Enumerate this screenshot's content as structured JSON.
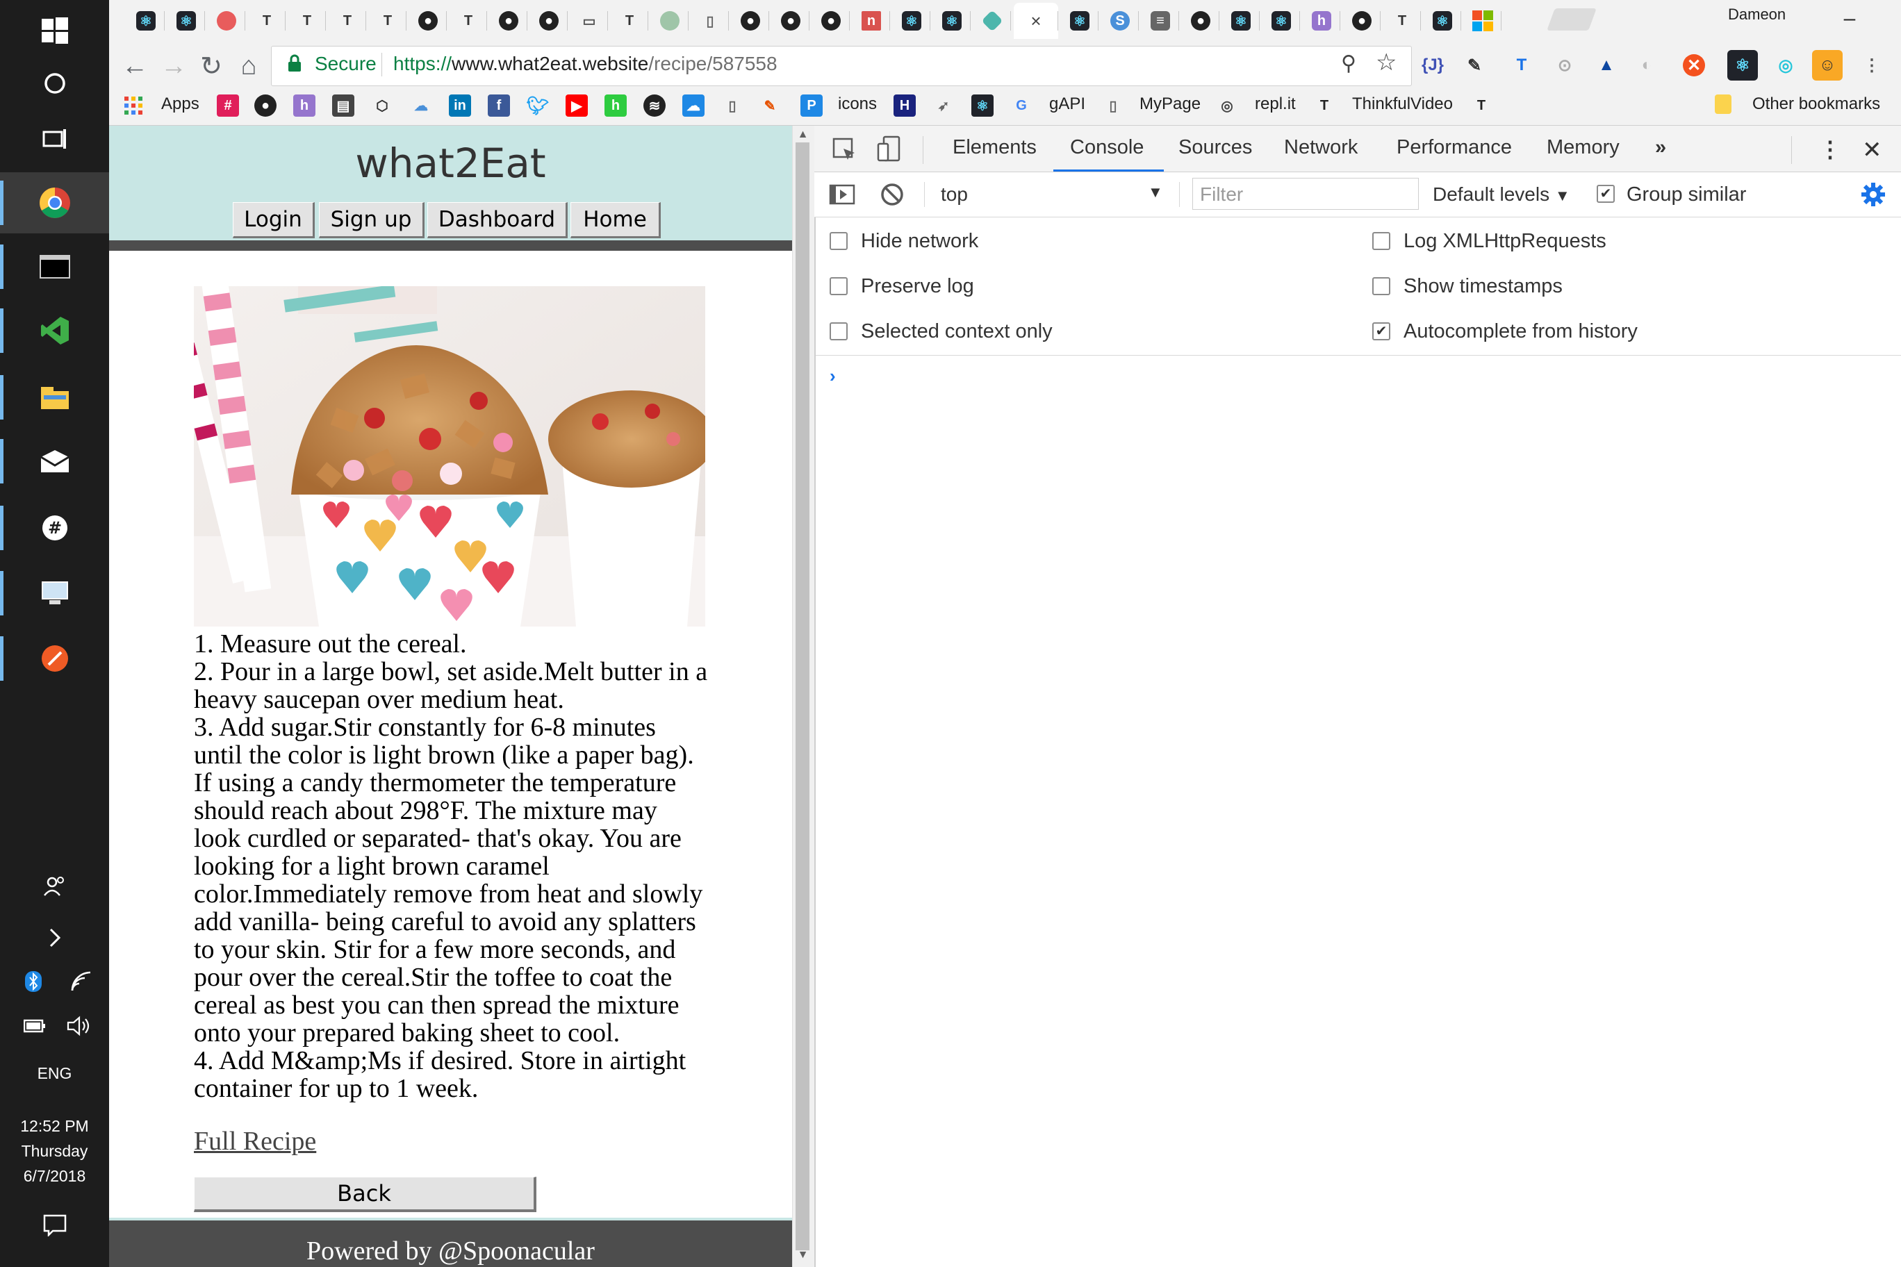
{
  "taskbar": {
    "clock_time": "12:52 PM",
    "clock_day": "Thursday",
    "clock_date": "6/7/2018",
    "language": "ENG"
  },
  "browser": {
    "user_name": "Dameon",
    "secure_label": "Secure",
    "url": {
      "scheme": "https://",
      "host": "www.what2eat.website",
      "path": "/recipe/587558"
    },
    "bookmarks": {
      "apps": "Apps",
      "icons": "icons",
      "gapi": "gAPI",
      "mypage": "MyPage",
      "replit": "repl.it",
      "thinkful": "ThinkfulVideo",
      "other": "Other bookmarks"
    },
    "extensions": {
      "json": "{J}"
    }
  },
  "site": {
    "title": "what2Eat",
    "nav": [
      "Login",
      "Sign up",
      "Dashboard",
      "Home"
    ],
    "steps": [
      "1. Measure out the cereal.",
      "2. Pour in a large bowl, set aside.Melt butter in a heavy saucepan over medium heat.",
      "3. Add sugar.Stir constantly for 6-8 minutes until the color is light brown (like a paper bag). If using a candy thermometer the temperature should reach about 298°F. The mixture may look curdled or separated- that's okay. You are looking for a light brown caramel color.Immediately remove from heat and slowly add vanilla- being careful to avoid any splatters to your skin. Stir for a few more seconds, and pour over the cereal.Stir the toffee to coat the cereal as best you can then spread the mixture onto your prepared baking sheet to cool.",
      "4. Add M&amp;Ms if desired. Store in airtight container for up to 1 week."
    ],
    "full_recipe_link": "Full Recipe",
    "back_button": "Back",
    "footer": "Powered by @Spoonacular"
  },
  "devtools": {
    "tabs": [
      "Elements",
      "Console",
      "Sources",
      "Network",
      "Performance",
      "Memory"
    ],
    "selected_tab": "Console",
    "context": "top",
    "filter_placeholder": "Filter",
    "levels": "Default levels",
    "group_similar": "Group similar",
    "options_left": [
      {
        "label": "Hide network",
        "checked": false
      },
      {
        "label": "Preserve log",
        "checked": false
      },
      {
        "label": "Selected context only",
        "checked": false
      }
    ],
    "options_right": [
      {
        "label": "Log XMLHttpRequests",
        "checked": false
      },
      {
        "label": "Show timestamps",
        "checked": false
      },
      {
        "label": "Autocomplete from history",
        "checked": true
      }
    ],
    "prompt": "›"
  },
  "colors": {
    "site_header": "#c8e6e4",
    "site_dark": "#4d4d4d",
    "devtools_accent": "#1a73e8",
    "secure_green": "#0b8043"
  }
}
